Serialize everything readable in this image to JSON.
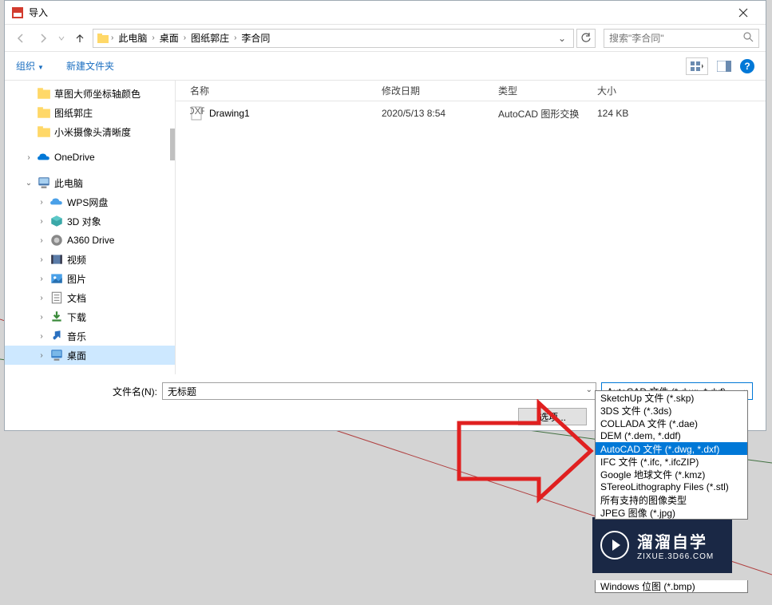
{
  "dialog": {
    "title": "导入"
  },
  "nav": {
    "breadcrumbs": [
      "此电脑",
      "桌面",
      "图纸郭庄",
      "李合同"
    ],
    "search_placeholder": "搜索\"李合同\""
  },
  "toolbar": {
    "organize": "组织",
    "new_folder": "新建文件夹"
  },
  "sidebar": {
    "items_top": [
      {
        "label": "草图大师坐标轴颜色",
        "type": "folder"
      },
      {
        "label": "图纸郭庄",
        "type": "folder"
      },
      {
        "label": "小米摄像头清晰度",
        "type": "folder"
      }
    ],
    "onedrive": "OneDrive",
    "this_pc": "此电脑",
    "pc_items": [
      {
        "label": "WPS网盘",
        "icon": "cloud"
      },
      {
        "label": "3D 对象",
        "icon": "3d"
      },
      {
        "label": "A360 Drive",
        "icon": "a360"
      },
      {
        "label": "视频",
        "icon": "video"
      },
      {
        "label": "图片",
        "icon": "pictures"
      },
      {
        "label": "文档",
        "icon": "documents"
      },
      {
        "label": "下载",
        "icon": "downloads"
      },
      {
        "label": "音乐",
        "icon": "music"
      },
      {
        "label": "桌面",
        "icon": "desktop",
        "selected": true
      }
    ]
  },
  "file_headers": {
    "name": "名称",
    "date": "修改日期",
    "type": "类型",
    "size": "大小"
  },
  "files": [
    {
      "name": "Drawing1",
      "date": "2020/5/13 8:54",
      "type": "AutoCAD 图形交换",
      "size": "124 KB"
    }
  ],
  "filename": {
    "label": "文件名(N):",
    "value": "无标题"
  },
  "filetype": {
    "selected": "AutoCAD 文件 (*.dwg, *.dxf)",
    "options": [
      "SketchUp 文件 (*.skp)",
      "3DS 文件 (*.3ds)",
      "COLLADA 文件 (*.dae)",
      "DEM (*.dem, *.ddf)",
      "AutoCAD 文件 (*.dwg, *.dxf)",
      "IFC 文件 (*.ifc, *.ifcZIP)",
      "Google 地球文件 (*.kmz)",
      "STereoLithography Files (*.stl)",
      "所有支持的图像类型",
      "JPEG 图像 (*.jpg)"
    ],
    "option_bottom": "Windows 位图 (*.bmp)",
    "selected_index": 4
  },
  "options_btn": "选项...",
  "watermark": {
    "line1": "溜溜自学",
    "line2": "ZIXUE.3D66.COM"
  }
}
